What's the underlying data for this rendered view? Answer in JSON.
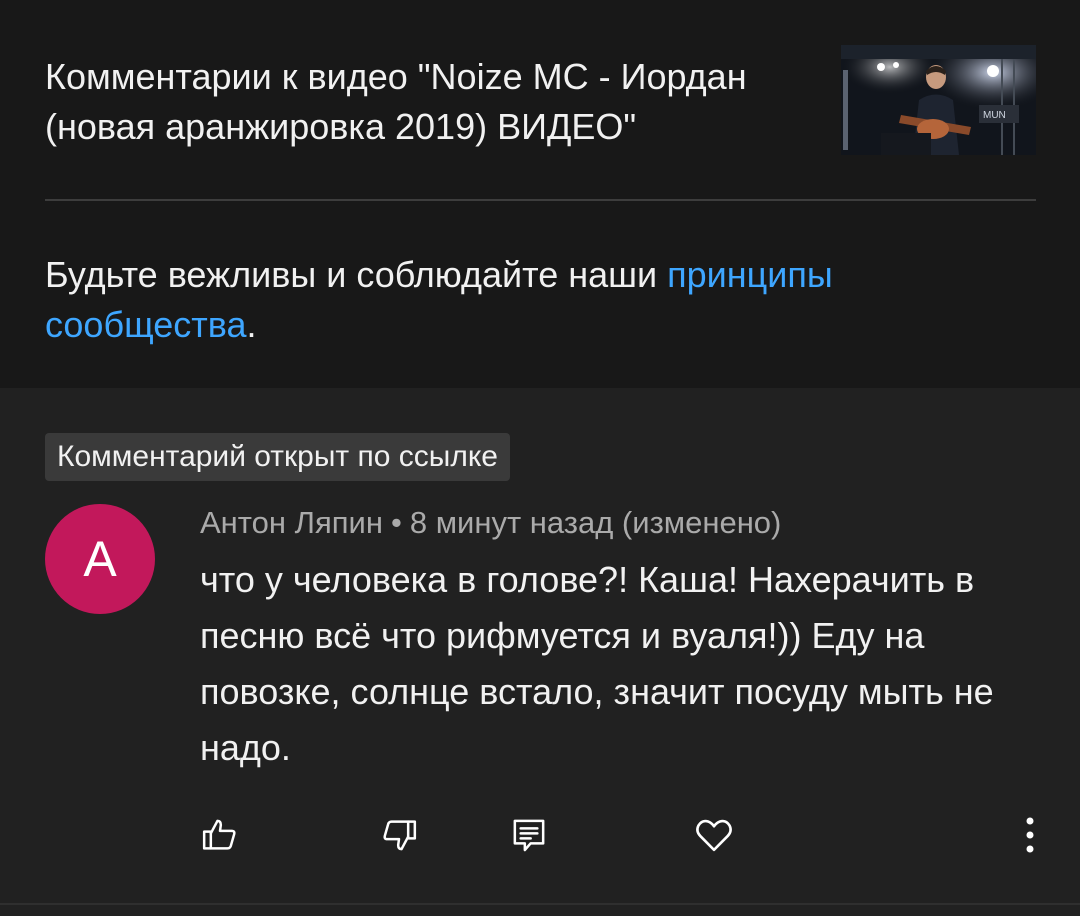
{
  "video": {
    "title": "Комментарии к видео \"Noize MC - Иордан (новая аранжировка 2019) ВИДЕО\"",
    "thumbnail_icon": "video-thumbnail-guitarist"
  },
  "guidelines": {
    "text_before": "Будьте вежливы и соблюдайте наши ",
    "link_text": "принципы сообщества",
    "text_after": "."
  },
  "comment": {
    "linked_badge": "Комментарий открыт по ссылке",
    "avatar_letter": "А",
    "avatar_color": "#c2185b",
    "author": "Антон Ляпин",
    "separator": "•",
    "time": "8 минут назад (изменено)",
    "text": "что у человека в голове?! Каша! Нахерачить в песню всё что рифмуется и вуаля!)) Еду на повозке, солнце встало, значит посуду мыть не надо."
  },
  "actions": {
    "like_icon": "thumbs-up-icon",
    "dislike_icon": "thumbs-down-icon",
    "reply_icon": "comment-reply-icon",
    "heart_icon": "heart-icon",
    "more_icon": "more-vertical-icon"
  },
  "colors": {
    "header_bg": "#181818",
    "body_bg": "#212121",
    "link": "#3ea6ff",
    "meta_text": "#aaaaaa"
  }
}
